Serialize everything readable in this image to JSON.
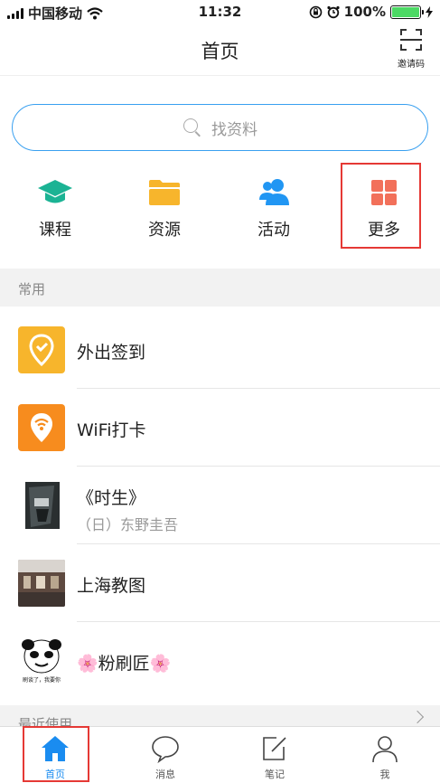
{
  "status_bar": {
    "carrier": "中国移动",
    "time": "11:32",
    "battery": "100%"
  },
  "header": {
    "title": "首页",
    "invite_label": "邀请码"
  },
  "search": {
    "placeholder": "找资料"
  },
  "quick_actions": [
    {
      "label": "课程",
      "icon": "graduation-cap-icon",
      "color": "#1bb394"
    },
    {
      "label": "资源",
      "icon": "folder-icon",
      "color": "#f7b52c"
    },
    {
      "label": "活动",
      "icon": "people-icon",
      "color": "#2196f3"
    },
    {
      "label": "更多",
      "icon": "grid-icon",
      "color": "#f2705a"
    }
  ],
  "common_section": {
    "label": "常用",
    "items": [
      {
        "title": "外出签到",
        "subtitle": "",
        "icon": "location-check-icon",
        "color": "#f7b52c"
      },
      {
        "title": "WiFi打卡",
        "subtitle": "",
        "icon": "wifi-location-icon",
        "color": "#f78c1e"
      },
      {
        "title": "《时生》",
        "subtitle": "（日）东野圭吾",
        "icon": "book-cover-thumbnail"
      },
      {
        "title": "上海教图",
        "subtitle": "",
        "icon": "library-photo-thumbnail"
      },
      {
        "title": "🌸粉刷匠🌸",
        "subtitle": "",
        "icon": "meme-avatar-thumbnail",
        "thumb_caption": "刷谈了，我要你"
      }
    ]
  },
  "recent_section": {
    "label": "最近使用"
  },
  "tab_bar": [
    {
      "label": "首页",
      "icon": "home-icon",
      "active": true
    },
    {
      "label": "消息",
      "icon": "chat-bubble-icon",
      "active": false
    },
    {
      "label": "笔记",
      "icon": "note-edit-icon",
      "active": false
    },
    {
      "label": "我",
      "icon": "person-icon",
      "active": false
    }
  ],
  "colors": {
    "accent": "#1a8cf0",
    "highlight_box": "#e53935",
    "search_border": "#39a0f0"
  }
}
